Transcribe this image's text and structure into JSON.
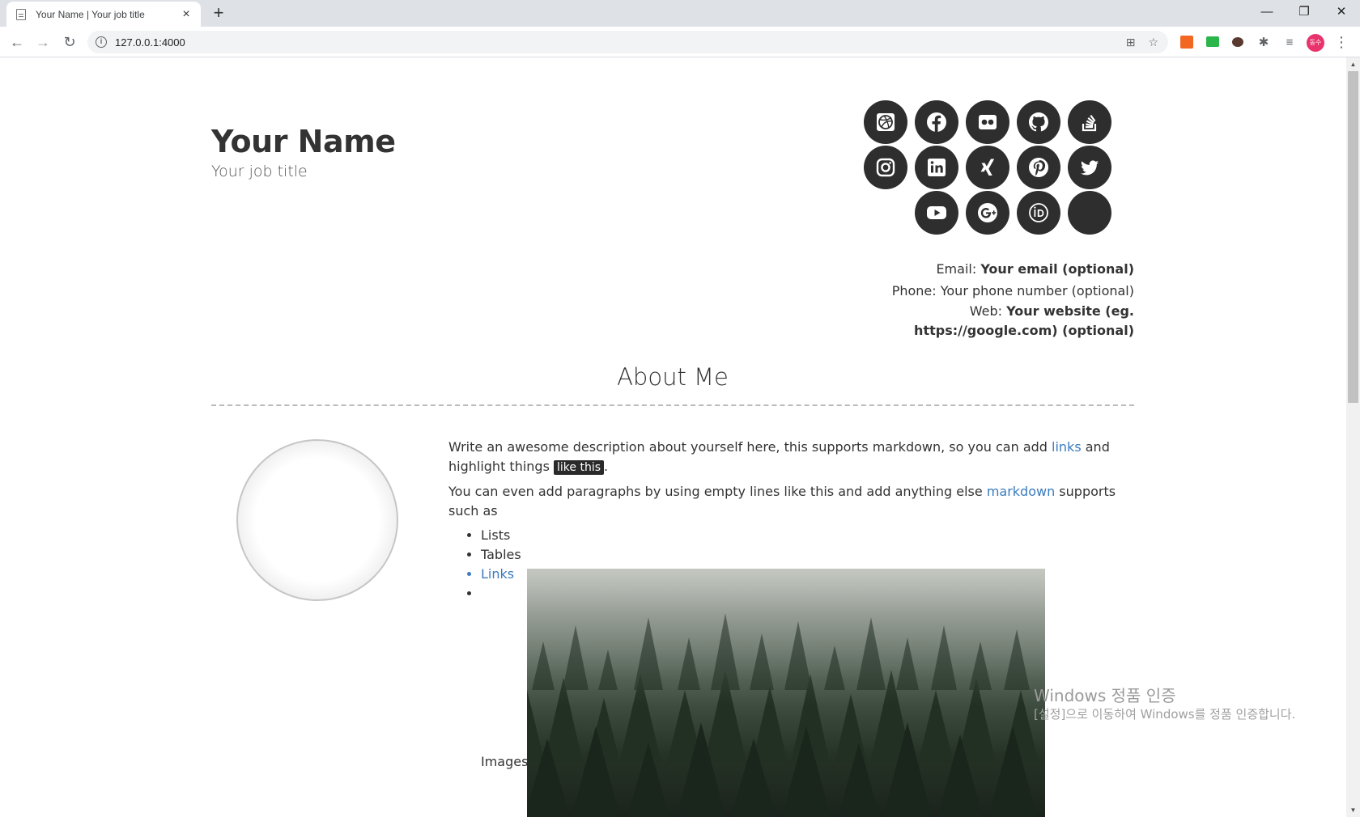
{
  "browser": {
    "tab_title": "Your Name | Your job title",
    "url": "127.0.0.1:4000",
    "avatar_text": "동수"
  },
  "header": {
    "name": "Your Name",
    "job_title": "Your job title"
  },
  "social_icons": [
    "dribbble-icon",
    "facebook-icon",
    "flickr-icon",
    "github-icon",
    "stackoverflow-icon",
    "instagram-icon",
    "linkedin-icon",
    "xing-icon",
    "pinterest-icon",
    "twitter-icon",
    "youtube-icon",
    "google-plus-icon",
    "orcid-icon",
    "blank-icon"
  ],
  "contact": {
    "email_label": "Email:",
    "email_value": "Your email (optional)",
    "phone_label": "Phone:",
    "phone_value": "Your phone number (optional)",
    "web_label": "Web:",
    "web_value": "Your website (eg. https://google.com) (optional)"
  },
  "about": {
    "title": "About Me",
    "p1_before": "Write an awesome description about yourself here, this supports markdown, so you can add ",
    "p1_link": "links",
    "p1_mid": " and highlight things ",
    "p1_highlight": "like this",
    "p1_after": ".",
    "p2_before": "You can even add paragraphs by using empty lines like this and add anything else ",
    "p2_link": "markdown",
    "p2_after": " supports such as",
    "list": [
      "Lists",
      "Tables",
      "Links",
      "Images"
    ]
  },
  "watermark": {
    "line1": "Windows 정품 인증",
    "line2": "[설정]으로 이동하여 Windows를 정품 인증합니다."
  },
  "colors": {
    "icon_bg": "#2e2e2e",
    "link": "#3b7bbf"
  }
}
